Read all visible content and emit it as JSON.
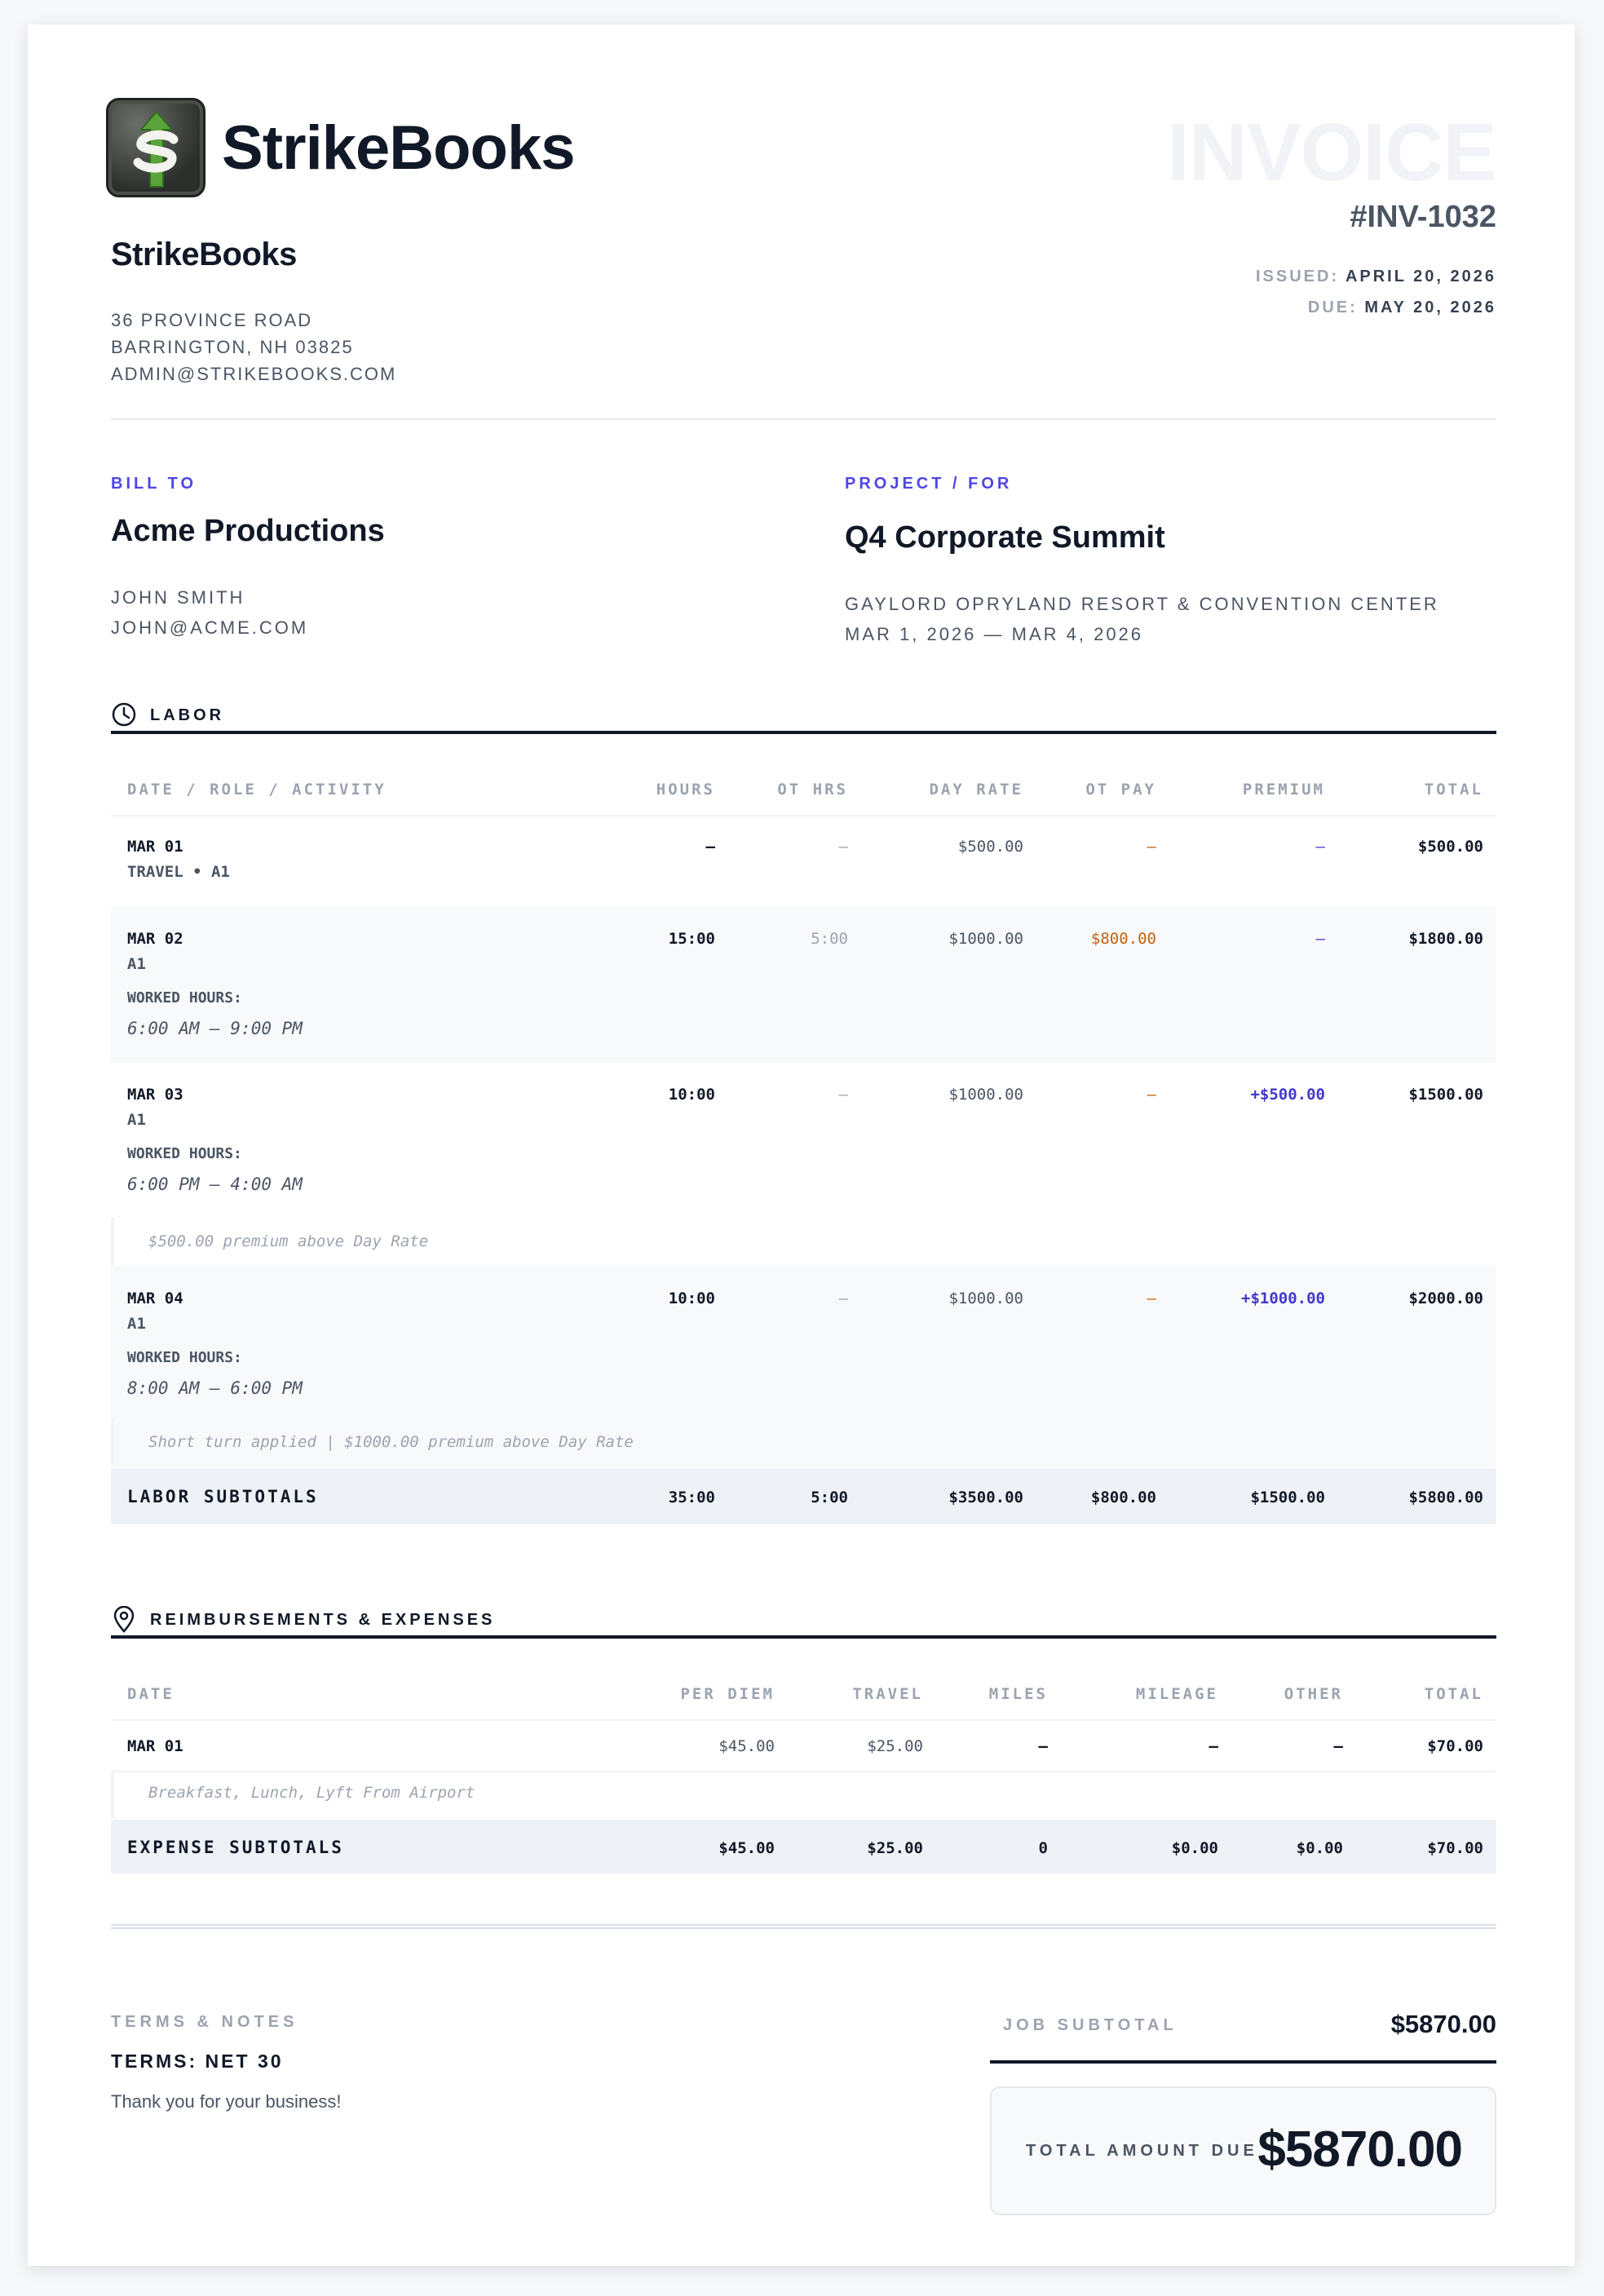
{
  "company": {
    "logo_text": "StrikeBooks",
    "name": "StrikeBooks",
    "address_lines": [
      "36 PROVINCE ROAD",
      "BARRINGTON, NH 03825",
      "ADMIN@STRIKEBOOKS.COM"
    ]
  },
  "invoice": {
    "word": "INVOICE",
    "number": "#INV-1032",
    "issued_label": "ISSUED:",
    "issued": "APRIL 20, 2026",
    "due_label": "DUE:",
    "due": "MAY 20, 2026"
  },
  "bill_to": {
    "label": "BILL TO",
    "name": "Acme Productions",
    "contact": "JOHN SMITH",
    "email": "JOHN@ACME.COM"
  },
  "project": {
    "label": "PROJECT / FOR",
    "name": "Q4 Corporate Summit",
    "venue": "GAYLORD OPRYLAND RESORT & CONVENTION CENTER",
    "dates": "MAR 1, 2026 — MAR 4, 2026"
  },
  "labor": {
    "title": "LABOR",
    "icon": "clock-icon",
    "headers": [
      "DATE / ROLE / ACTIVITY",
      "HOURS",
      "OT HRS",
      "DAY RATE",
      "OT PAY",
      "PREMIUM",
      "TOTAL"
    ],
    "rows": [
      {
        "date": "MAR 01",
        "role": "TRAVEL • A1",
        "hours": "—",
        "ot_hrs": "—",
        "day_rate": "$500.00",
        "ot_pay": "—",
        "premium": "—",
        "total": "$500.00"
      },
      {
        "date": "MAR 02",
        "role": "A1",
        "worked_label": "WORKED HOURS:",
        "worked": "6:00 AM — 9:00 PM",
        "hours": "15:00",
        "ot_hrs": "5:00",
        "day_rate": "$1000.00",
        "ot_pay": "$800.00",
        "premium": "—",
        "total": "$1800.00"
      },
      {
        "date": "MAR 03",
        "role": "A1",
        "worked_label": "WORKED HOURS:",
        "worked": "6:00 PM — 4:00 AM",
        "hours": "10:00",
        "ot_hrs": "—",
        "day_rate": "$1000.00",
        "ot_pay": "—",
        "premium": "+$500.00",
        "total": "$1500.00",
        "note": "$500.00 premium above Day Rate"
      },
      {
        "date": "MAR 04",
        "role": "A1",
        "worked_label": "WORKED HOURS:",
        "worked": "8:00 AM — 6:00 PM",
        "hours": "10:00",
        "ot_hrs": "—",
        "day_rate": "$1000.00",
        "ot_pay": "—",
        "premium": "+$1000.00",
        "total": "$2000.00",
        "note": "Short turn applied | $1000.00 premium above Day Rate"
      }
    ],
    "subtotals": {
      "label": "LABOR SUBTOTALS",
      "hours": "35:00",
      "ot_hrs": "5:00",
      "day_rate": "$3500.00",
      "ot_pay": "$800.00",
      "premium": "$1500.00",
      "total": "$5800.00"
    }
  },
  "expenses": {
    "title": "REIMBURSEMENTS & EXPENSES",
    "icon": "map-pin-icon",
    "headers": [
      "DATE",
      "PER DIEM",
      "TRAVEL",
      "MILES",
      "MILEAGE",
      "OTHER",
      "TOTAL"
    ],
    "rows": [
      {
        "date": "MAR 01",
        "per_diem": "$45.00",
        "travel": "$25.00",
        "miles": "—",
        "mileage": "—",
        "other": "—",
        "total": "$70.00",
        "note": "Breakfast, Lunch, Lyft From Airport"
      }
    ],
    "subtotals": {
      "label": "EXPENSE SUBTOTALS",
      "per_diem": "$45.00",
      "travel": "$25.00",
      "miles": "0",
      "mileage": "$0.00",
      "other": "$0.00",
      "total": "$70.00"
    }
  },
  "footer": {
    "terms_label": "TERMS & NOTES",
    "terms": "TERMS: NET 30",
    "thanks": "Thank you for your business!",
    "job_subtotal_label": "JOB SUBTOTAL",
    "job_subtotal": "$5870.00",
    "total_due_label": "TOTAL AMOUNT DUE",
    "total_due": "$5870.00"
  },
  "colors": {
    "accent": "#4f46e5",
    "ot_orange": "#c2620c",
    "premium_purple": "#4338ca",
    "ink": "#111827"
  }
}
